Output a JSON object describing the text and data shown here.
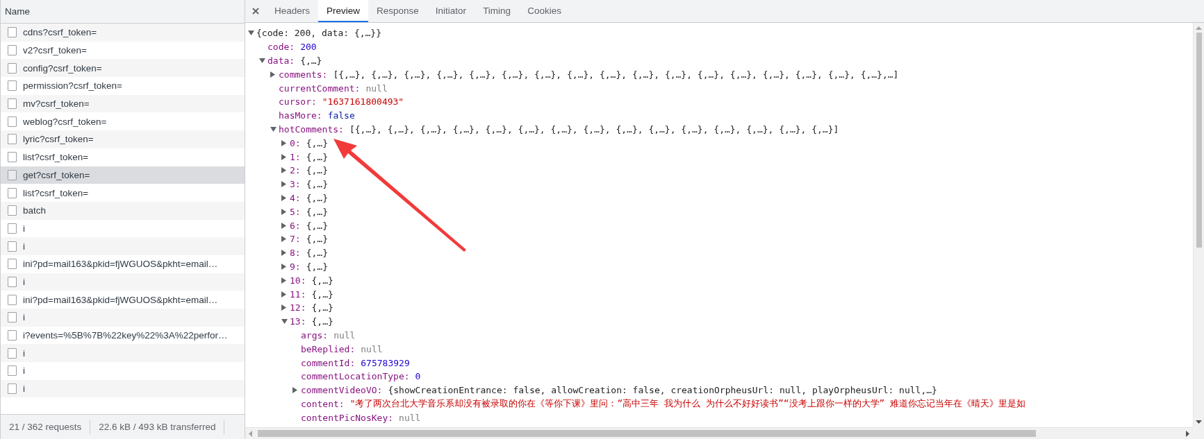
{
  "network": {
    "column_header": "Name",
    "requests": [
      {
        "name": "cdns?csrf_token=",
        "selected": false
      },
      {
        "name": "v2?csrf_token=",
        "selected": false
      },
      {
        "name": "config?csrf_token=",
        "selected": false
      },
      {
        "name": "permission?csrf_token=",
        "selected": false
      },
      {
        "name": "mv?csrf_token=",
        "selected": false
      },
      {
        "name": "weblog?csrf_token=",
        "selected": false
      },
      {
        "name": "lyric?csrf_token=",
        "selected": false
      },
      {
        "name": "list?csrf_token=",
        "selected": false
      },
      {
        "name": "get?csrf_token=",
        "selected": true
      },
      {
        "name": "list?csrf_token=",
        "selected": false
      },
      {
        "name": "batch",
        "selected": false
      },
      {
        "name": "i",
        "selected": false
      },
      {
        "name": "i",
        "selected": false
      },
      {
        "name": "ini?pd=mail163&pkid=fjWGUOS&pkht=email…",
        "selected": false
      },
      {
        "name": "i",
        "selected": false
      },
      {
        "name": "ini?pd=mail163&pkid=fjWGUOS&pkht=email…",
        "selected": false
      },
      {
        "name": "i",
        "selected": false
      },
      {
        "name": "i?events=%5B%7B%22key%22%3A%22perfor…",
        "selected": false
      },
      {
        "name": "i",
        "selected": false
      },
      {
        "name": "i",
        "selected": false
      },
      {
        "name": "i",
        "selected": false
      }
    ],
    "status": {
      "requests": "21 / 362 requests",
      "transferred": "22.6 kB / 493 kB transferred"
    }
  },
  "detail": {
    "tabs": [
      {
        "label": "Headers",
        "selected": false
      },
      {
        "label": "Preview",
        "selected": true
      },
      {
        "label": "Response",
        "selected": false
      },
      {
        "label": "Initiator",
        "selected": false
      },
      {
        "label": "Timing",
        "selected": false
      },
      {
        "label": "Cookies",
        "selected": false
      }
    ],
    "preview": {
      "value": "{code: 200, data: {,…}}",
      "kind": "object",
      "expanded": true,
      "children": [
        {
          "key": "code:",
          "value": "200",
          "kind": "number"
        },
        {
          "key": "data:",
          "value": "{,…}",
          "kind": "object",
          "expanded": true,
          "children": [
            {
              "key": "comments:",
              "value": "[{,…}, {,…}, {,…}, {,…}, {,…}, {,…}, {,…}, {,…}, {,…}, {,…}, {,…}, {,…}, {,…}, {,…}, {,…}, {,…}, {,…},…]",
              "kind": "object",
              "expanded": false
            },
            {
              "key": "currentComment:",
              "value": "null",
              "kind": "null"
            },
            {
              "key": "cursor:",
              "value": "\"1637161800493\"",
              "kind": "string"
            },
            {
              "key": "hasMore:",
              "value": "false",
              "kind": "boolean"
            },
            {
              "key": "hotComments:",
              "value": "[{,…}, {,…}, {,…}, {,…}, {,…}, {,…}, {,…}, {,…}, {,…}, {,…}, {,…}, {,…}, {,…}, {,…}, {,…}]",
              "kind": "object",
              "expanded": true,
              "children": [
                {
                  "key": "0:",
                  "value": "{,…}",
                  "kind": "object",
                  "expanded": false
                },
                {
                  "key": "1:",
                  "value": "{,…}",
                  "kind": "object",
                  "expanded": false
                },
                {
                  "key": "2:",
                  "value": "{,…}",
                  "kind": "object",
                  "expanded": false
                },
                {
                  "key": "3:",
                  "value": "{,…}",
                  "kind": "object",
                  "expanded": false
                },
                {
                  "key": "4:",
                  "value": "{,…}",
                  "kind": "object",
                  "expanded": false
                },
                {
                  "key": "5:",
                  "value": "{,…}",
                  "kind": "object",
                  "expanded": false
                },
                {
                  "key": "6:",
                  "value": "{,…}",
                  "kind": "object",
                  "expanded": false
                },
                {
                  "key": "7:",
                  "value": "{,…}",
                  "kind": "object",
                  "expanded": false
                },
                {
                  "key": "8:",
                  "value": "{,…}",
                  "kind": "object",
                  "expanded": false
                },
                {
                  "key": "9:",
                  "value": "{,…}",
                  "kind": "object",
                  "expanded": false
                },
                {
                  "key": "10:",
                  "value": "{,…}",
                  "kind": "object",
                  "expanded": false
                },
                {
                  "key": "11:",
                  "value": "{,…}",
                  "kind": "object",
                  "expanded": false
                },
                {
                  "key": "12:",
                  "value": "{,…}",
                  "kind": "object",
                  "expanded": false
                },
                {
                  "key": "13:",
                  "value": "{,…}",
                  "kind": "object",
                  "expanded": true,
                  "children": [
                    {
                      "key": "args:",
                      "value": "null",
                      "kind": "null"
                    },
                    {
                      "key": "beReplied:",
                      "value": "null",
                      "kind": "null"
                    },
                    {
                      "key": "commentId:",
                      "value": "675783929",
                      "kind": "number"
                    },
                    {
                      "key": "commentLocationType:",
                      "value": "0",
                      "kind": "number"
                    },
                    {
                      "key": "commentVideoVO:",
                      "value": "{showCreationEntrance: false, allowCreation: false, creationOrpheusUrl: null, playOrpheusUrl: null,…}",
                      "kind": "object",
                      "expanded": false
                    },
                    {
                      "key": "content:",
                      "value": "\"考了两次台北大学音乐系却没有被录取的你在《等你下课》里问：“高中三年 我为什么 为什么不好好读书”“没考上跟你一样的大学”  难道你忘记当年在《晴天》里是如",
                      "kind": "string"
                    },
                    {
                      "key": "contentPicNosKey:",
                      "value": "null",
                      "kind": "null"
                    }
                  ]
                }
              ]
            }
          ]
        }
      ]
    }
  }
}
